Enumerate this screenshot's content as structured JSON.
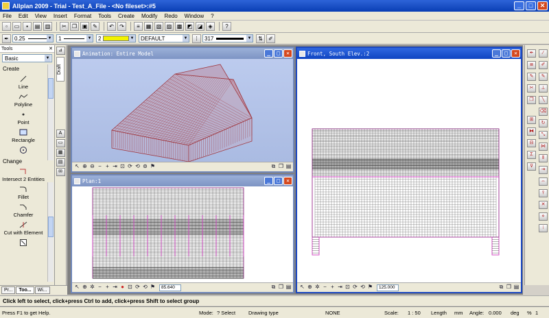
{
  "app": {
    "title": "Allplan 2009 - Trial - Test_A_File - <No fileset>:#5"
  },
  "window_controls": {
    "minimize": "_",
    "maximize": "□",
    "close": "✕"
  },
  "menu": [
    "File",
    "Edit",
    "View",
    "Insert",
    "Format",
    "Tools",
    "Create",
    "Modify",
    "Redo",
    "Window",
    "?"
  ],
  "format_bar": {
    "pen_thickness": "0.25",
    "line_type": "1",
    "color_number": "2",
    "layer": "DEFAULT",
    "pattern_number": "317"
  },
  "tools_palette": {
    "header": "Tools",
    "category": "Basic",
    "draft_tab": "Draft",
    "sections": {
      "create": "Create",
      "change": "Change"
    },
    "create_tools": [
      "Line",
      "Polyline",
      "Point",
      "Rectangle"
    ],
    "change_tools": [
      "Intersect 2 Entities",
      "Fillet",
      "Chamfer",
      "Cut with Element"
    ]
  },
  "bottom_tabs": [
    "Pr...",
    "Too...",
    "Wi..."
  ],
  "windows": {
    "animation": {
      "title": "Animation: Entire Model"
    },
    "plan": {
      "title": "Plan:1",
      "scale": "85.640"
    },
    "front": {
      "title": "Front, South Elev.:2",
      "scale": "125.000"
    }
  },
  "hint": "Click left to select, click+press Ctrl to add, click+press Shift to select group",
  "status": {
    "help": "Press F1 to get Help.",
    "mode_label": "Mode:",
    "mode_value": "? Select",
    "drawing_type_label": "Drawing type",
    "drawing_type_value": "NONE",
    "scale_label": "Scale:",
    "scale_value": "1 : 50",
    "length_label": "Length",
    "length_unit": "mm",
    "angle_label": "Angle:",
    "angle_value": "0.000",
    "angle_unit": "deg",
    "percent_label": "%",
    "percent_value": "1"
  },
  "colors": {
    "titlebar": "#0a3fb4",
    "chrome": "#ece9d8",
    "model_lines": "#a03840",
    "pink_outline": "#d040c0",
    "sky": "#b9c9ec"
  }
}
